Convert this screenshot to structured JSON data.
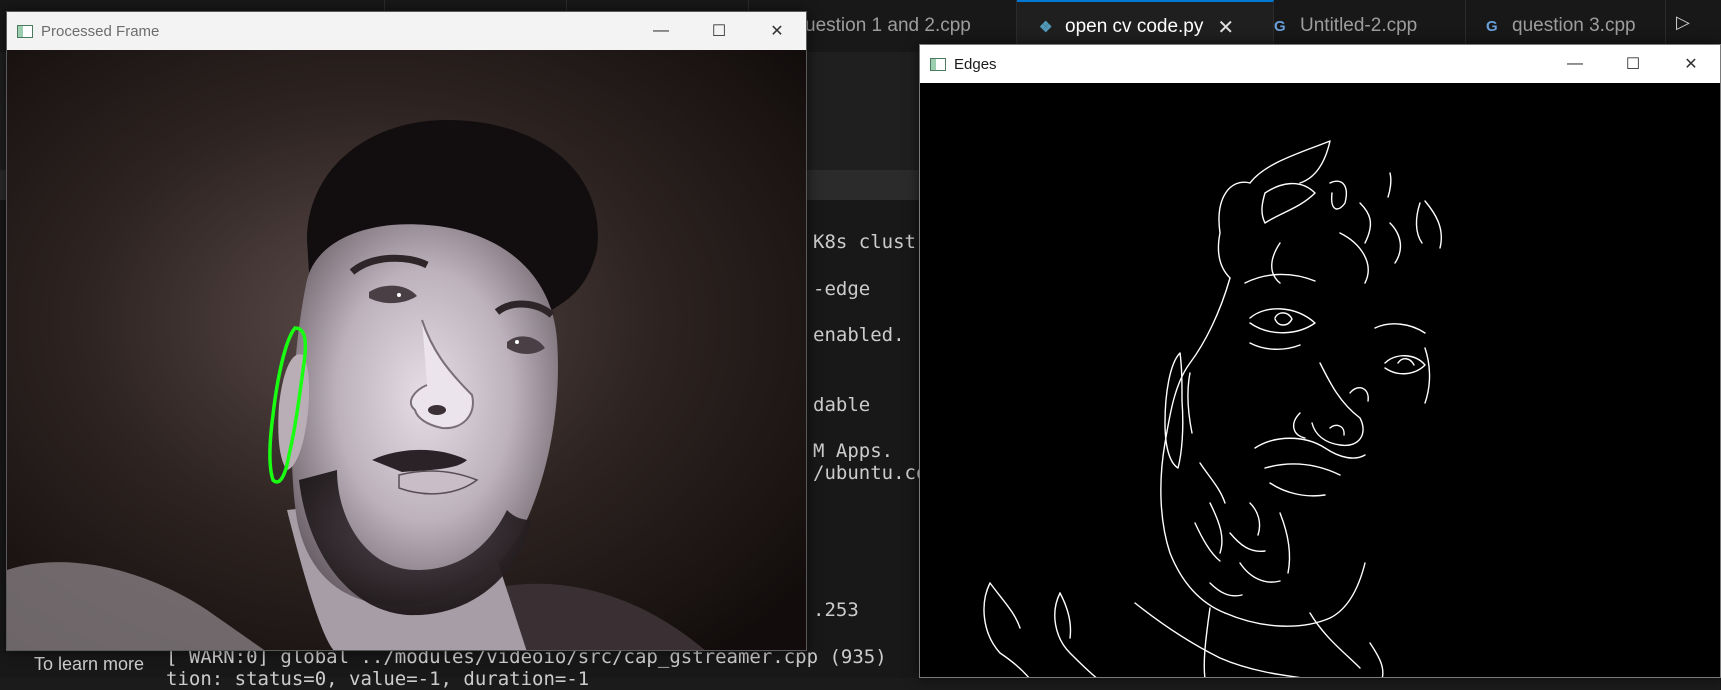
{
  "editor": {
    "tabs": [
      {
        "label": "",
        "icon": "",
        "active": false
      },
      {
        "label": "",
        "icon": "",
        "active": false
      },
      {
        "label": "",
        "icon": "",
        "active": false
      },
      {
        "label": "uestion 1 and 2.cpp",
        "icon": "",
        "active": false
      },
      {
        "label": "open cv code.py",
        "icon": "python-icon",
        "active": true
      },
      {
        "label": "Untitled-2.cpp",
        "icon": "cpp-icon",
        "active": false
      },
      {
        "label": "question 3.cpp",
        "icon": "cpp-icon",
        "active": false
      }
    ],
    "close_glyph": "✕",
    "run_glyph": "▷"
  },
  "terminal": {
    "lines": [
      "K8s clust",
      "-edge",
      "enabled.",
      "dable",
      "M Apps.",
      "/ubuntu.co",
      ".253",
      "[ WARN:0] global ../modules/videoio/src/cap_gstreamer.cpp (935)",
      "tion: status=0, value=-1, duration=-1"
    ],
    "learn_more": "To learn more"
  },
  "windows": {
    "processed": {
      "title": "Processed Frame",
      "minimize_glyph": "—",
      "maximize_glyph": "☐",
      "close_glyph": "✕",
      "contour_color": "#19ff12"
    },
    "edges": {
      "title": "Edges",
      "minimize_glyph": "—",
      "maximize_glyph": "☐",
      "close_glyph": "✕"
    }
  }
}
